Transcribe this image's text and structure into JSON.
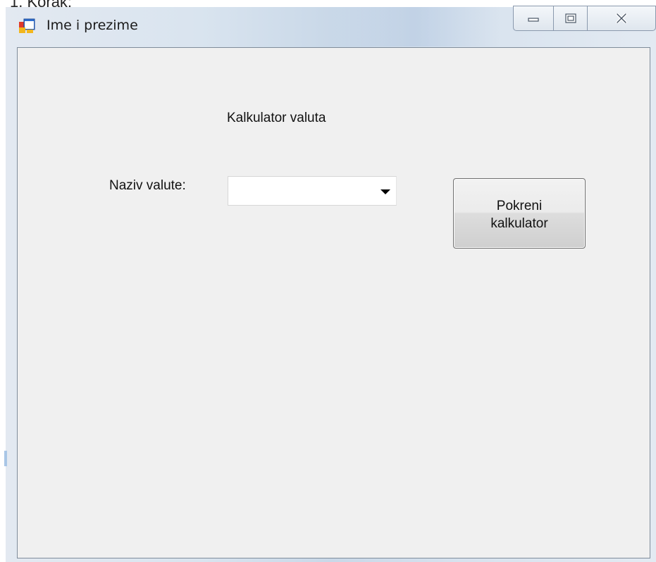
{
  "document": {
    "caption": "1.   Korak:"
  },
  "window": {
    "title": "Ime i prezime",
    "app_icon": "winforms-app-icon",
    "controls": {
      "minimize_icon": "minimize-icon",
      "maximize_icon": "maximize-icon",
      "close_icon": "close-icon"
    }
  },
  "form": {
    "heading": "Kalkulator valuta",
    "currency_label": "Naziv valute:",
    "currency_combo": {
      "value": "",
      "icon": "chevron-down-icon"
    },
    "run_button_label": "Pokreni kalkulator"
  },
  "colors": {
    "client_background": "#f0f0f0",
    "frame_glass": "#d6e1ed",
    "button_face": "#e6e6e6"
  }
}
